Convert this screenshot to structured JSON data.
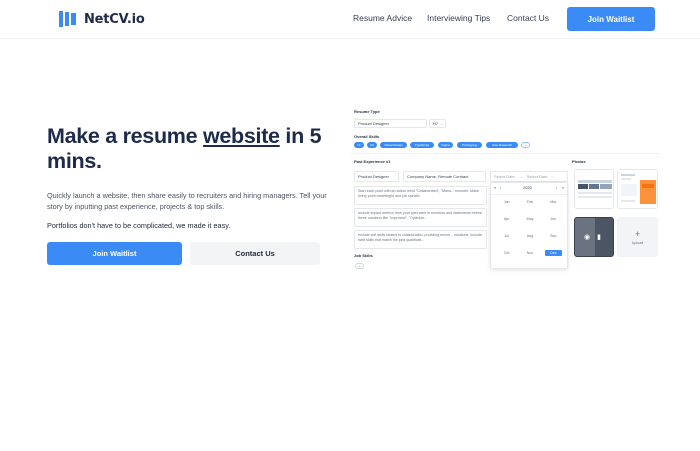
{
  "nav": {
    "logo_text": "NetCV.io",
    "links": [
      "Resume Advice",
      "Interviewing Tips",
      "Contact Us"
    ],
    "cta": "Join Waitlist"
  },
  "hero": {
    "title_part1": "Make a resume ",
    "title_highlight": "website",
    "title_part2": " in 5 mins.",
    "description": "Quickly launch a website, then share easily to recruiters and hiring managers. Tell your story by inputting past experience, projects & top skills.",
    "note": "Portfolios don't have to be complicated, we made it easy.",
    "primary_button": "Join Waitlist",
    "secondary_button": "Contact Us"
  },
  "mockup": {
    "resume_type_label": "Resume Type",
    "resume_type_value": "Product Designer",
    "resume_type_level": "H7",
    "skills_label": "Overall Skills",
    "skills": [
      "UI",
      "UX",
      "Visual Design",
      "TypeScript",
      "Figma",
      "Prototyping",
      "User Research"
    ],
    "skills_add": "+",
    "experience_label": "Past Experience #1",
    "experience_role": "Product Designer",
    "experience_company": "Company Name, Remote Contract",
    "date_start": "Select Date",
    "date_arrow": "→",
    "date_end": "Select Date",
    "bullets": [
      "Start each point with an action word \"Collaborated\", \"Mana... recruiter. Make every point meaningful and job specific.",
      "Include impact metrics from your past work in numbers and statements before these numbers like \"Improved\", \"Optimize...",
      "Include soft skills related to collaboration, providing recom... solutions. Include hard skills that match the jobs qualificati..."
    ],
    "job_skills_label": "Job Skills",
    "job_skills_add": "+",
    "photos_label": "Photos",
    "upload_plus": "+",
    "upload_label": "Upload",
    "calendar": {
      "year": "2020",
      "prev_year": "«",
      "prev": "‹",
      "next": "›",
      "next_year": "»",
      "months": [
        "Jan",
        "Feb",
        "Mar",
        "Apr",
        "May",
        "Jun",
        "Jul",
        "Aug",
        "Sep",
        "Oct",
        "Nov",
        "Dec"
      ],
      "selected": "Dec"
    }
  },
  "colors": {
    "accent": "#3b8bf6",
    "heading": "#1e2a4a",
    "body_text": "#4b5563",
    "secondary_button_bg": "#f3f4f6"
  }
}
